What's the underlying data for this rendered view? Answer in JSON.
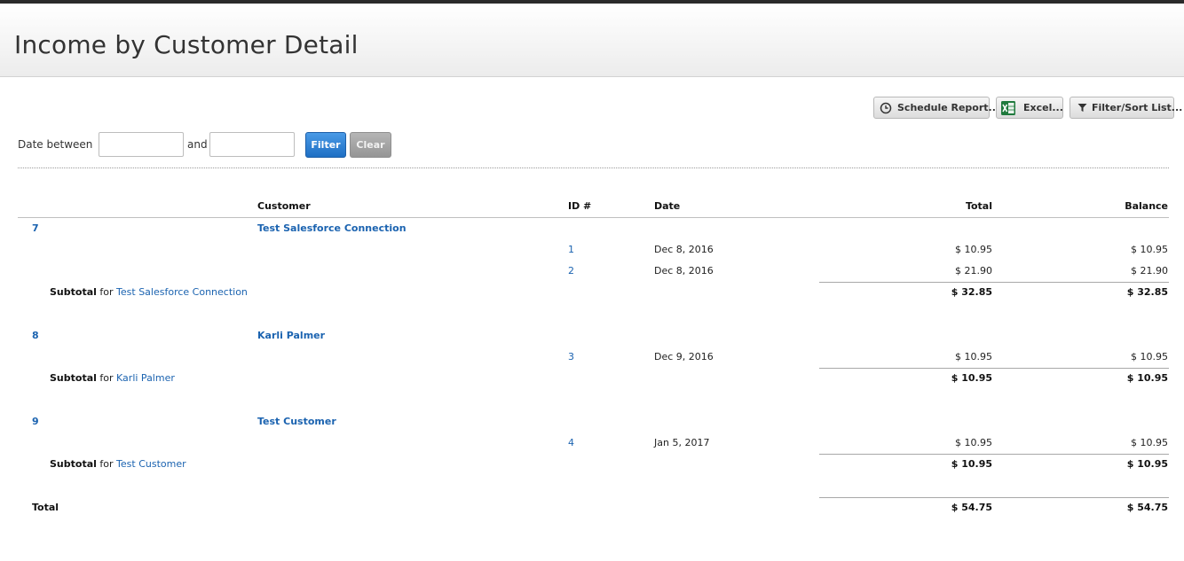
{
  "page": {
    "title": "Income by Customer Detail"
  },
  "toolbar": {
    "schedule_label": "Schedule Report...",
    "excel_label": "Excel...",
    "filter_sort_label": "Filter/Sort List..."
  },
  "filter": {
    "date_between_label": "Date between",
    "and_label": "and",
    "from_value": "",
    "to_value": "",
    "filter_button": "Filter",
    "clear_button": "Clear"
  },
  "table": {
    "headers": {
      "customer": "Customer",
      "id": "ID #",
      "date": "Date",
      "total": "Total",
      "balance": "Balance"
    },
    "groups": [
      {
        "number": "7",
        "customer": "Test Salesforce Connection",
        "rows": [
          {
            "id": "1",
            "date": "Dec 8, 2016",
            "total": "$ 10.95",
            "balance": "$ 10.95"
          },
          {
            "id": "2",
            "date": "Dec 8, 2016",
            "total": "$ 21.90",
            "balance": "$ 21.90"
          }
        ],
        "subtotal_label": "Subtotal",
        "for_label": "for",
        "subtotal_name": "Test Salesforce Connection",
        "subtotal_total": "$ 32.85",
        "subtotal_balance": "$ 32.85"
      },
      {
        "number": "8",
        "customer": "Karli Palmer",
        "rows": [
          {
            "id": "3",
            "date": "Dec 9, 2016",
            "total": "$ 10.95",
            "balance": "$ 10.95"
          }
        ],
        "subtotal_label": "Subtotal",
        "for_label": "for",
        "subtotal_name": "Karli Palmer",
        "subtotal_total": "$ 10.95",
        "subtotal_balance": "$ 10.95"
      },
      {
        "number": "9",
        "customer": "Test Customer",
        "rows": [
          {
            "id": "4",
            "date": "Jan 5, 2017",
            "total": "$ 10.95",
            "balance": "$ 10.95"
          }
        ],
        "subtotal_label": "Subtotal",
        "for_label": "for",
        "subtotal_name": "Test Customer",
        "subtotal_total": "$ 10.95",
        "subtotal_balance": "$ 10.95"
      }
    ],
    "grand_total": {
      "label": "Total",
      "total": "$ 54.75",
      "balance": "$ 54.75"
    }
  },
  "colors": {
    "link": "#1b63b0",
    "filter_button": "#1e6fc4",
    "clear_button": "#a3a3a3"
  },
  "icons": {
    "schedule": "clock-icon",
    "excel": "excel-icon",
    "filter_sort": "funnel-icon"
  }
}
